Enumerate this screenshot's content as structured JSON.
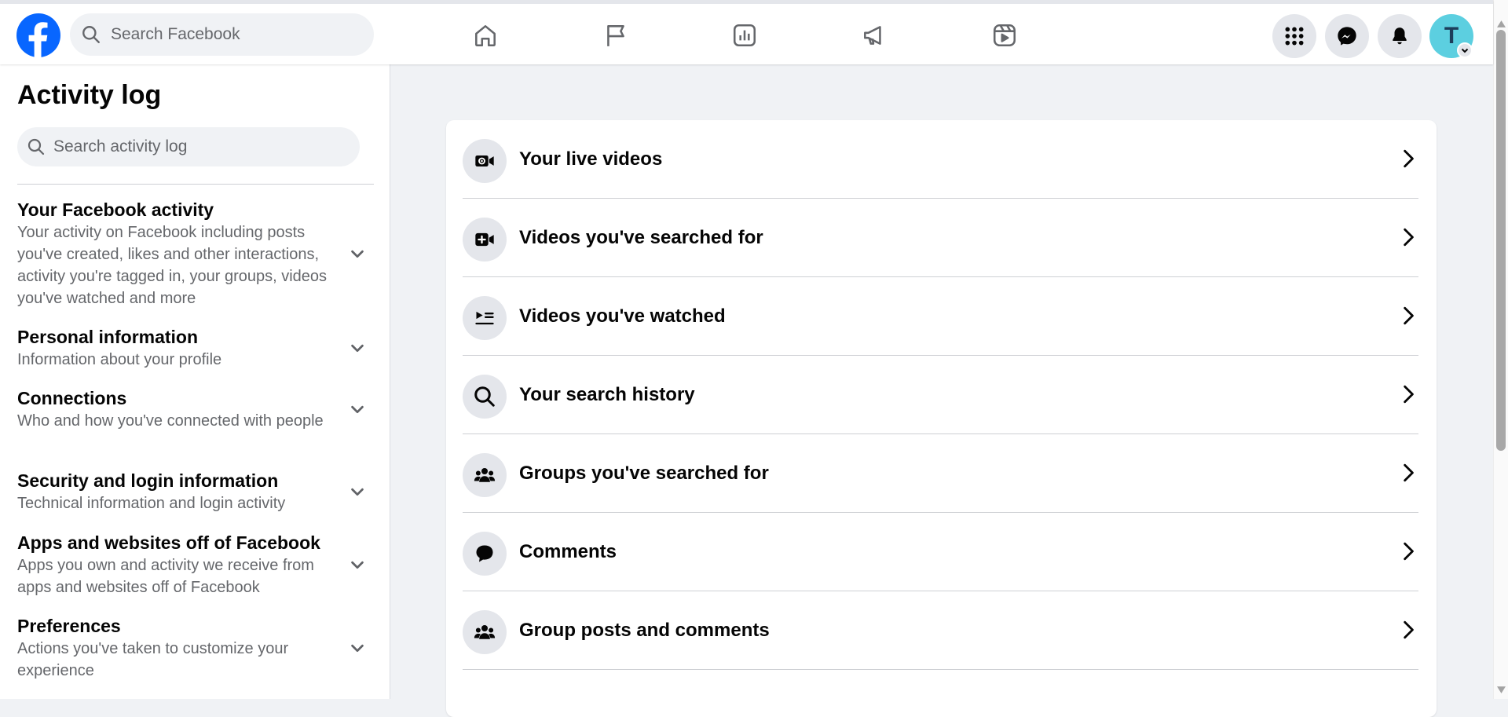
{
  "header": {
    "search_placeholder": "Search Facebook",
    "nav": [
      "home-icon",
      "pages-flag-icon",
      "insights-icon",
      "ad-center-icon",
      "reels-icon"
    ],
    "actions": [
      "menu-grid-icon",
      "messenger-icon",
      "notifications-bell-icon"
    ],
    "avatar_initial": "T",
    "brand_color": "#0866ff"
  },
  "sidebar": {
    "title": "Activity log",
    "search_placeholder": "Search activity log",
    "categories": [
      {
        "title": "Your Facebook activity",
        "description": "Your activity on Facebook including posts you've created, likes and other interactions, activity you're tagged in, your groups, videos you've watched and more"
      },
      {
        "title": "Personal information",
        "description": "Information about your profile"
      },
      {
        "title": "Connections",
        "description": "Who and how you've connected with people"
      },
      {
        "title": "Security and login information",
        "description": "Technical information and login activity"
      },
      {
        "title": "Apps and websites off of Facebook",
        "description": "Apps you own and activity we receive from apps and websites off of Facebook"
      },
      {
        "title": "Preferences",
        "description": "Actions you've taken to customize your experience"
      }
    ]
  },
  "main": {
    "items": [
      {
        "label": "Your live videos",
        "icon": "live-video-icon"
      },
      {
        "label": "Videos you've searched for",
        "icon": "video-search-icon"
      },
      {
        "label": "Videos you've watched",
        "icon": "watched-videos-icon"
      },
      {
        "label": "Your search history",
        "icon": "search-icon"
      },
      {
        "label": "Groups you've searched for",
        "icon": "groups-icon"
      },
      {
        "label": "Comments",
        "icon": "comment-icon"
      },
      {
        "label": "Group posts and comments",
        "icon": "groups-icon"
      }
    ]
  }
}
